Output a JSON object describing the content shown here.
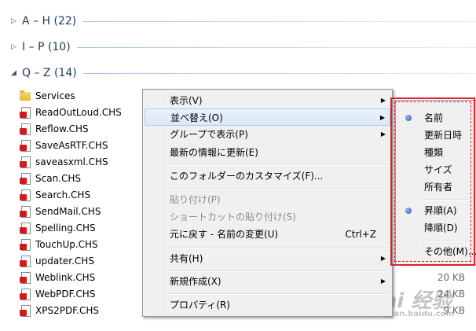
{
  "groups": [
    {
      "label": "A – H (22)",
      "expanded": false
    },
    {
      "label": "I – P (10)",
      "expanded": false
    },
    {
      "label": "Q – Z (14)",
      "expanded": true
    }
  ],
  "files": [
    {
      "name": "Services",
      "icon": "folder-icon"
    },
    {
      "name": "ReadOutLoud.CHS",
      "icon": "document-icon"
    },
    {
      "name": "Reflow.CHS",
      "icon": "document-icon"
    },
    {
      "name": "SaveAsRTF.CHS",
      "icon": "document-icon"
    },
    {
      "name": "saveasxml.CHS",
      "icon": "document-icon"
    },
    {
      "name": "Scan.CHS",
      "icon": "document-icon"
    },
    {
      "name": "Search.CHS",
      "icon": "document-icon"
    },
    {
      "name": "SendMail.CHS",
      "icon": "document-icon"
    },
    {
      "name": "Spelling.CHS",
      "icon": "document-icon"
    },
    {
      "name": "TouchUp.CHS",
      "icon": "document-icon"
    },
    {
      "name": "updater.CHS",
      "icon": "document-icon"
    },
    {
      "name": "Weblink.CHS",
      "icon": "document-icon"
    },
    {
      "name": "WebPDF.CHS",
      "icon": "document-icon"
    },
    {
      "name": "XPS2PDF.CHS",
      "icon": "document-icon"
    }
  ],
  "sizes": {
    "weblink": "20 KB",
    "webpdf": "24 KB",
    "xps2pdf": "9 KB"
  },
  "context_menu": {
    "view": "表示(V)",
    "sort_by": "並べ替え(O)",
    "group_by": "グループで表示(P)",
    "refresh": "最新の情報に更新(E)",
    "customize": "このフォルダーのカスタマイズ(F)...",
    "paste": "貼り付け(P)",
    "paste_shortcut": "ショートカットの貼り付け(S)",
    "undo_rename": "元に戻す - 名前の変更(U)",
    "undo_shortcut": "Ctrl+Z",
    "share": "共有(H)",
    "new": "新規作成(X)",
    "properties": "プロパティ(R)"
  },
  "sort_submenu": {
    "name": "名前",
    "date_modified": "更新日時",
    "type": "種類",
    "size": "サイズ",
    "owner": "所有者",
    "ascending": "昇順(A)",
    "descending": "降順(D)",
    "more": "その他(M)...",
    "selected_field": "名前",
    "selected_order": "昇順(A)"
  },
  "watermark": {
    "brand": "Bai 经验",
    "sub": "jingyan.baidu.com"
  },
  "colors": {
    "group_header": "#1e395b",
    "highlight_border": "#e0202c",
    "menu_bg": "#f0f0f0",
    "radio": "#2f4fb5"
  }
}
